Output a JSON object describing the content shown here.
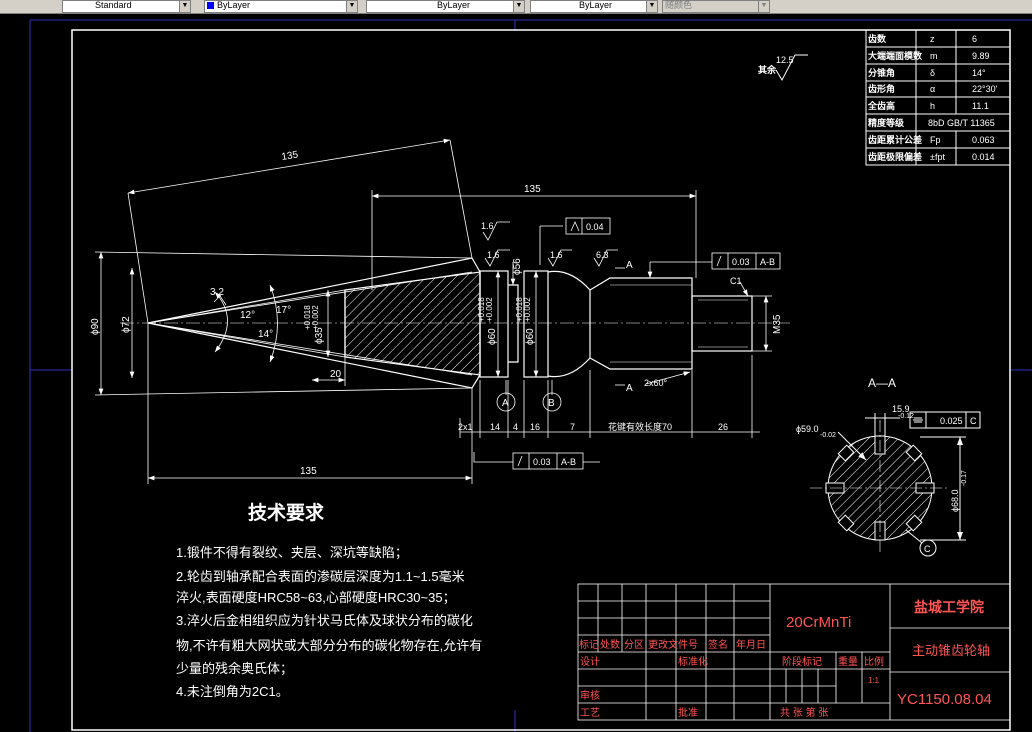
{
  "toolbar": {
    "textstyle": "Standard",
    "layer_color": "ByLayer",
    "linetype": "ByLayer",
    "lineweight": "ByLayer",
    "plotstyle": "随颜色"
  },
  "params_table": [
    {
      "name": "齿数",
      "symbol": "z",
      "value": "6"
    },
    {
      "name": "大端端面模数",
      "symbol": "m",
      "value": "9.89"
    },
    {
      "name": "分锥角",
      "symbol": "δ",
      "value": "14°"
    },
    {
      "name": "齿形角",
      "symbol": "α",
      "value": "22°30'"
    },
    {
      "name": "全齿高",
      "symbol": "h",
      "value": "11.1"
    },
    {
      "name": "精度等级",
      "symbol": "",
      "value": "8bD GB/T 11365"
    },
    {
      "name": "齿距累计公差",
      "symbol": "Fp",
      "value": "0.063"
    },
    {
      "name": "齿距极限偏差",
      "symbol": "±fpt",
      "value": "0.014"
    }
  ],
  "roughness_rest": {
    "value": "12.5",
    "label": "其余"
  },
  "dims": {
    "d135_slant": "135",
    "d135_top": "135",
    "d135_bottom": "135",
    "phi90": "ϕ90",
    "phi72": "ϕ72",
    "a32": "3.2",
    "a12": "12°",
    "a17": "17°",
    "a14": "14°",
    "phi35": "ϕ35",
    "phi35_tol_up": "+0.018",
    "phi35_tol_dn": "+0.002",
    "d20": "20",
    "phi56": "ϕ56",
    "phi60a": "ϕ60",
    "phi60a_tol_up": "+0.018",
    "phi60a_tol_dn": "+0.002",
    "phi60b": "ϕ60",
    "phi60b_tol_up": "+0.018",
    "phi60b_tol_dn": "+0.002",
    "r16a": "1.6",
    "r16b": "1.6",
    "r16c": "1.6",
    "r63": "6.3",
    "sec_a_top": "A",
    "sec_a_bot": "A",
    "perp_tol": "0.04",
    "runout_top": "0.03",
    "runout_top_ref": "A-B",
    "runout_bottom": "0.03",
    "runout_bottom_ref": "A-B",
    "c1": "C1",
    "m35": "M35",
    "cham": "2x60°",
    "datum_a": "A",
    "datum_b": "B",
    "seg1": "2x1",
    "seg2": "14",
    "seg3": "4",
    "seg4": "16",
    "seg5": "7",
    "spline_len": "花键有效长度70",
    "seg6": "26"
  },
  "section": {
    "title": "A—A",
    "d159": "15.9",
    "d159_tol": "-0.12",
    "sym_tol": "0.025",
    "sym_ref": "C",
    "phi59": "ϕ59.0",
    "phi59_tol": "-0.02",
    "phi68": "ϕ68.0",
    "phi68_tol": "-0.17",
    "datum_c": "C"
  },
  "requirements": {
    "title": "技术要求",
    "lines": [
      "1.锻件不得有裂纹、夹层、深坑等缺陷；",
      "2.轮齿到轴承配合表面的渗碳层深度为1.1~1.5毫米",
      "淬火,表面硬度HRC58~63,心部硬度HRC30~35；",
      "3.淬火后金相组织应为针状马氏体及球状分布的碳化",
      "物,不许有粗大网状或大部分分布的碳化物存在,允许有",
      "少量的残余奥氏体；",
      "4.未注倒角为2C1。"
    ]
  },
  "title_block": {
    "material": "20CrMnTi",
    "school": "盐城工学院",
    "part_name": "主动锥齿轮轴",
    "drawing_no": "YC1150.08.04",
    "h_mark": "标记",
    "h_count": "处数",
    "h_zone": "分区",
    "h_docno": "更改文件号",
    "h_sign": "签名",
    "h_date": "年月日",
    "h_design": "设计",
    "h_std": "标准化",
    "h_stage": "阶段标记",
    "h_weight": "重量",
    "h_scale": "比例",
    "scale_val": "1:1",
    "h_review": "审核",
    "h_process": "工艺",
    "h_approve": "批准",
    "sheets": "共   张  第   张"
  }
}
